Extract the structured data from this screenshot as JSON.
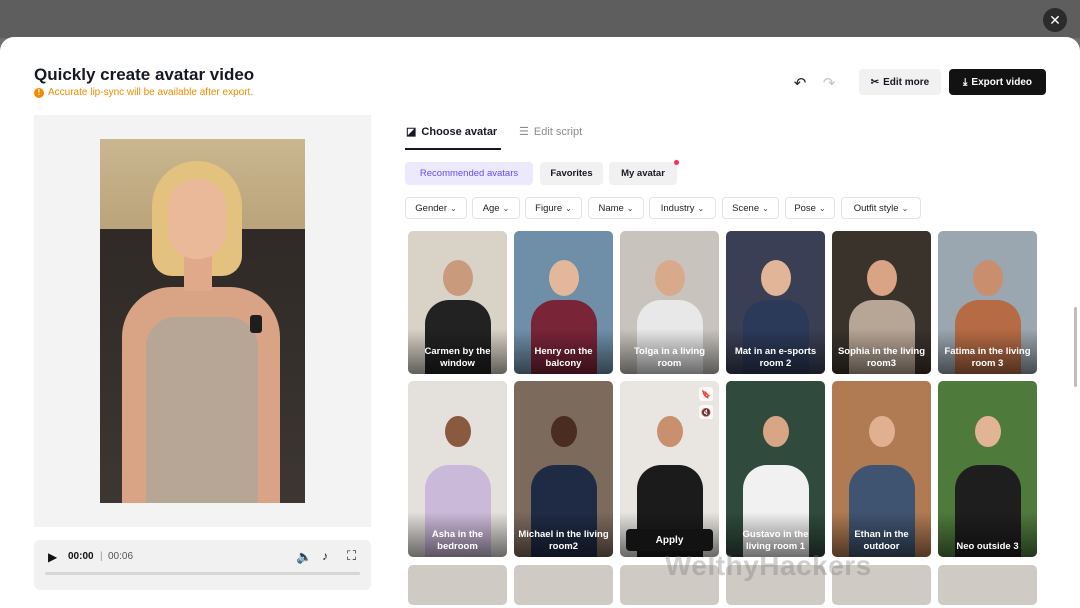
{
  "header": {
    "title": "Quickly create avatar video",
    "notice": "Accurate lip-sync will be available after export.",
    "edit_more": "Edit more",
    "export_video": "Export video"
  },
  "player": {
    "current": "00:00",
    "separator": "|",
    "total": "00:06",
    "progress": 0
  },
  "tabs": [
    {
      "label": "Choose avatar",
      "active": true
    },
    {
      "label": "Edit script",
      "active": false
    }
  ],
  "categories": [
    {
      "label": "Recommended avatars",
      "active": true
    },
    {
      "label": "Favorites"
    },
    {
      "label": "My avatar",
      "has_dot": true
    }
  ],
  "filters": [
    "Gender",
    "Age",
    "Figure",
    "Name",
    "Industry",
    "Scene",
    "Pose",
    "Outfit style"
  ],
  "avatars": [
    {
      "label": "Carmen by the window",
      "bg": "#d9d2c7",
      "skin": "#c99a7c",
      "cloth": "#222222"
    },
    {
      "label": "Henry on the balcony",
      "bg": "#6f8fa8",
      "skin": "#e2b79b",
      "cloth": "#7a2438"
    },
    {
      "label": "Tolga in a living room",
      "bg": "#c8c4bd",
      "skin": "#d8a98a",
      "cloth": "#e8e8e8"
    },
    {
      "label": "Mat in an e-sports room 2",
      "bg": "#3a3f55",
      "skin": "#e1b597",
      "cloth": "#2c3a59"
    },
    {
      "label": "Sophia in the living room3",
      "bg": "#3a332c",
      "skin": "#d9a386",
      "cloth": "#b7a595",
      "selected": true
    },
    {
      "label": "Fatima in the living room 3",
      "bg": "#9aa6b0",
      "skin": "#c98e6e",
      "cloth": "#b66b45"
    },
    {
      "label": "Asha in the bedroom",
      "bg": "#e4e1dc",
      "skin": "#8a5a3e",
      "cloth": "#cbb9d9"
    },
    {
      "label": "Michael in the living room2",
      "bg": "#7c6a5d",
      "skin": "#4a2c20",
      "cloth": "#1f2b45"
    },
    {
      "label": "Apply",
      "bg": "#e9e6e1",
      "skin": "#c9906f",
      "cloth": "#1b1b1b",
      "hovered": true
    },
    {
      "label": "Gustavo in the living room 1",
      "bg": "#304a3d",
      "skin": "#d8a585",
      "cloth": "#f1f1f1"
    },
    {
      "label": "Ethan in the outdoor",
      "bg": "#b07a52",
      "skin": "#e0b091",
      "cloth": "#3f5470"
    },
    {
      "label": "Neo outside 3",
      "bg": "#4e7a3c",
      "skin": "#e2b496",
      "cloth": "#1e1e1e"
    }
  ],
  "icons": {
    "close": "close-icon",
    "undo": "undo-icon",
    "redo": "redo-icon",
    "scissors": "scissors-icon",
    "download": "download-icon",
    "play": "play-icon",
    "volume": "volume-icon",
    "tiktok": "tiktok-icon",
    "fullscreen": "fullscreen-icon"
  },
  "watermark": "WelthyHackers"
}
